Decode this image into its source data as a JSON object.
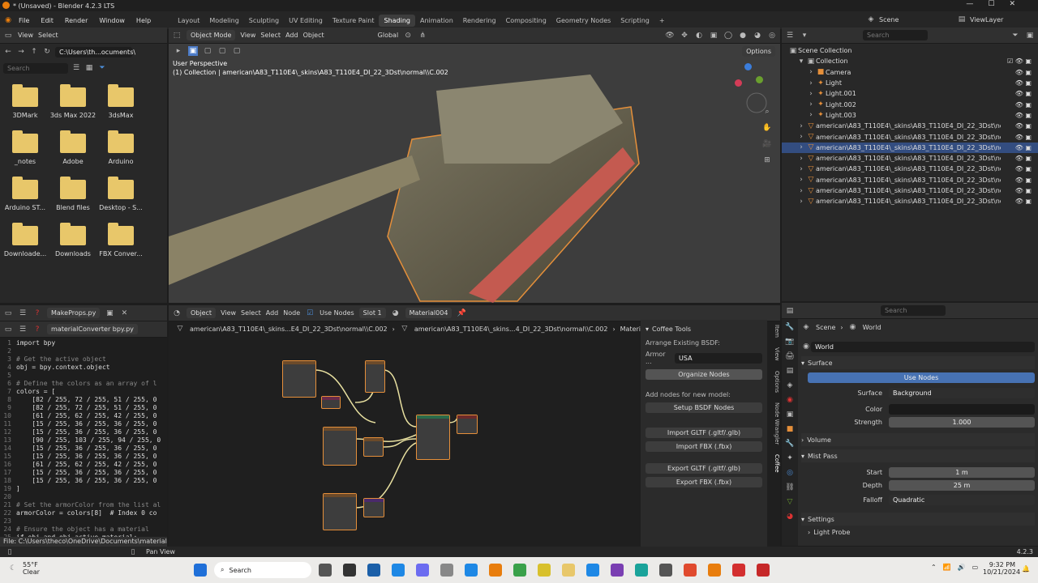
{
  "window": {
    "title": "* (Unsaved) - Blender 4.2.3 LTS"
  },
  "menu": [
    "File",
    "Edit",
    "Render",
    "Window",
    "Help"
  ],
  "workspaces": [
    "Layout",
    "Modeling",
    "Sculpting",
    "UV Editing",
    "Texture Paint",
    "Shading",
    "Animation",
    "Rendering",
    "Compositing",
    "Geometry Nodes",
    "Scripting"
  ],
  "active_workspace": "Shading",
  "scene": "Scene",
  "view_layer": "ViewLayer",
  "file_browser": {
    "view": "View",
    "select": "Select",
    "path": "C:\\Users\\th...ocuments\\",
    "search_placeholder": "Search",
    "folders": [
      "3DMark",
      "3ds Max 2022",
      "3dsMax",
      "_notes",
      "Adobe",
      "Arduino",
      "Arduino ST...",
      "Blend files",
      "Desktop - S...",
      "Downloade...",
      "Downloads",
      "FBX Conver..."
    ]
  },
  "viewport": {
    "mode": "Object Mode",
    "menu": [
      "View",
      "Select",
      "Add",
      "Object"
    ],
    "transform": "Global",
    "options": "Options",
    "title": "User Perspective",
    "subtitle": "(1) Collection | american\\A83_T110E4\\_skins\\A83_T110E4_DI_22_3Dst\\normal\\\\C.002"
  },
  "outliner": {
    "search": "Search",
    "root": "Scene Collection",
    "collection": "Collection",
    "items": [
      "Camera",
      "Light",
      "Light.001",
      "Light.002",
      "Light.003"
    ],
    "meshes": [
      "american\\A83_T110E4\\_skins\\A83_T110E4_DI_22_3Dst\\normal\\",
      "american\\A83_T110E4\\_skins\\A83_T110E4_DI_22_3Dst\\normal\\",
      "american\\A83_T110E4\\_skins\\A83_T110E4_DI_22_3Dst\\normal\\",
      "american\\A83_T110E4\\_skins\\A83_T110E4_DI_22_3Dst\\normal\\",
      "american\\A83_T110E4\\_skins\\A83_T110E4_DI_22_3Dst\\normal\\",
      "american\\A83_T110E4\\_skins\\A83_T110E4_DI_22_3Dst\\normal\\",
      "american\\A83_T110E4\\_skins\\A83_T110E4_DI_22_3Dst\\normal\\",
      "american\\A83_T110E4\\_skins\\A83_T110E4_DI_22_3Dst\\normal\\"
    ]
  },
  "text_editor": {
    "file1": "MakeProps.py",
    "file2": "materialConverter bpy.py",
    "lines": [
      {
        "n": "1",
        "t": "import bpy"
      },
      {
        "n": "2",
        "t": ""
      },
      {
        "n": "3",
        "t": "# Get the active object"
      },
      {
        "n": "4",
        "t": "obj = bpy.context.object"
      },
      {
        "n": "5",
        "t": ""
      },
      {
        "n": "6",
        "t": "# Define the colors as an array of l"
      },
      {
        "n": "7",
        "t": "colors = ["
      },
      {
        "n": "8",
        "t": "    [82 / 255, 72 / 255, 51 / 255, 0"
      },
      {
        "n": "9",
        "t": "    [82 / 255, 72 / 255, 51 / 255, 0"
      },
      {
        "n": "10",
        "t": "    [61 / 255, 62 / 255, 42 / 255, 0"
      },
      {
        "n": "11",
        "t": "    [15 / 255, 36 / 255, 36 / 255, 0"
      },
      {
        "n": "12",
        "t": "    [15 / 255, 36 / 255, 36 / 255, 0"
      },
      {
        "n": "13",
        "t": "    [90 / 255, 103 / 255, 94 / 255, 0"
      },
      {
        "n": "14",
        "t": "    [15 / 255, 36 / 255, 36 / 255, 0"
      },
      {
        "n": "15",
        "t": "    [15 / 255, 36 / 255, 36 / 255, 0"
      },
      {
        "n": "16",
        "t": "    [61 / 255, 62 / 255, 42 / 255, 0"
      },
      {
        "n": "17",
        "t": "    [15 / 255, 36 / 255, 36 / 255, 0"
      },
      {
        "n": "18",
        "t": "    [15 / 255, 36 / 255, 36 / 255, 0"
      },
      {
        "n": "19",
        "t": "]"
      },
      {
        "n": "20",
        "t": ""
      },
      {
        "n": "21",
        "t": "# Set the armorColor from the list al"
      },
      {
        "n": "22",
        "t": "armorColor = colors[8]  # Index 0 co"
      },
      {
        "n": "23",
        "t": ""
      },
      {
        "n": "24",
        "t": "# Ensure the object has a material"
      },
      {
        "n": "25",
        "t": "if obj and obj.active_material:"
      }
    ],
    "status": "File: C:\\Users\\theco\\OneDrive\\Documents\\materialConve"
  },
  "node_editor": {
    "object": "Object",
    "menu": [
      "View",
      "Select",
      "Add",
      "Node"
    ],
    "use_nodes": "Use Nodes",
    "slot": "Slot 1",
    "material": "Material004",
    "breadcrumb": [
      "american\\A83_T110E4\\_skins...E4_DI_22_3Dst\\normal\\\\C.002",
      "american\\A83_T110E4\\_skins...4_DI_22_3Dst\\normal\\\\C.002",
      "Material..."
    ]
  },
  "coffee": {
    "title": "Coffee Tools",
    "arrange": "Arrange Existing BSDF:",
    "armor_label": "Armor ...",
    "armor_value": "USA",
    "organize": "Organize Nodes",
    "add_nodes": "Add nodes for new model:",
    "setup": "Setup BSDF Nodes",
    "import_gltf": "Import GLTF (.gltf/.glb)",
    "import_fbx": "Import FBX (.fbx)",
    "export_gltf": "Export GLTF (.gltf/.glb)",
    "export_fbx": "Export FBX (.fbx)",
    "tabs": [
      "Item",
      "View",
      "Options",
      "Node Wrangler",
      "Coffee"
    ]
  },
  "properties": {
    "search": "Search",
    "crumb1": "Scene",
    "crumb2": "World",
    "world": "World",
    "surface": "Surface",
    "use_nodes": "Use Nodes",
    "surface_label": "Surface",
    "surface_value": "Background",
    "color_label": "Color",
    "strength_label": "Strength",
    "strength_value": "1.000",
    "volume": "Volume",
    "mist": "Mist Pass",
    "start_label": "Start",
    "start_value": "1 m",
    "depth_label": "Depth",
    "depth_value": "25 m",
    "falloff_label": "Falloff",
    "falloff_value": "Quadratic",
    "settings": "Settings",
    "light_probe": "Light Probe"
  },
  "statusbar": {
    "pan": "Pan View",
    "version": "4.2.3"
  },
  "taskbar": {
    "temp": "55°F",
    "weather": "Clear",
    "search": "Search",
    "time": "9:32 PM",
    "date": "10/21/2024"
  }
}
